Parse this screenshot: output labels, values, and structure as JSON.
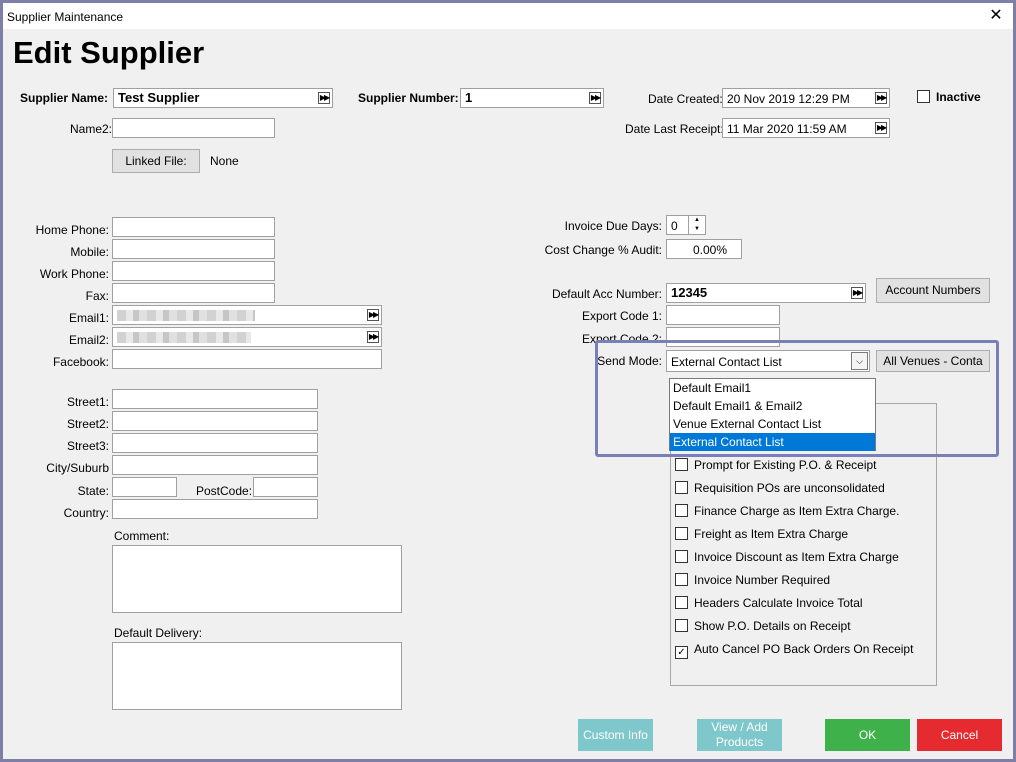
{
  "window": {
    "title": "Supplier Maintenance",
    "close_glyph": "✕"
  },
  "heading": "Edit Supplier",
  "supplier": {
    "name_label": "Supplier Name:",
    "name_value": "Test Supplier",
    "number_label": "Supplier Number:",
    "number_value": "1",
    "name2_label": "Name2:",
    "name2_value": "",
    "linked_file_button": "Linked File:",
    "linked_file_value": "None"
  },
  "dates": {
    "created_label": "Date Created:",
    "created_value": "20 Nov 2019 12:29 PM",
    "last_receipt_label": "Date Last Receipt:",
    "last_receipt_value": "11 Mar 2020 11:59 AM"
  },
  "inactive_label": "Inactive",
  "contact": {
    "home_phone_label": "Home Phone:",
    "mobile_label": "Mobile:",
    "work_phone_label": "Work Phone:",
    "fax_label": "Fax:",
    "email1_label": "Email1:",
    "email2_label": "Email2:",
    "facebook_label": "Facebook:"
  },
  "address": {
    "street1_label": "Street1:",
    "street2_label": "Street2:",
    "street3_label": "Street3:",
    "city_label": "City/Suburb",
    "state_label": "State:",
    "postcode_label": "PostCode:",
    "country_label": "Country:",
    "comment_label": "Comment:",
    "default_delivery_label": "Default Delivery:"
  },
  "billing": {
    "invoice_due_days_label": "Invoice Due Days:",
    "invoice_due_days_value": "0",
    "cost_change_label": "Cost Change % Audit:",
    "cost_change_value": "0.00%",
    "default_acc_label": "Default Acc Number:",
    "default_acc_value": "12345",
    "account_numbers_button": "Account Numbers",
    "export_code1_label": "Export Code 1:",
    "export_code2_label": "Export Code 2:",
    "send_mode_label": "Send Mode:",
    "send_mode_value": "External Contact List",
    "all_venues_button": "All Venues - Conta"
  },
  "send_mode_options": [
    "Default Email1",
    "Default Email1 & Email2",
    "Venue External Contact List",
    "External Contact List"
  ],
  "send_mode_selected_index": 3,
  "options": [
    {
      "label": "Prompt for Existing P.O. & Receipt",
      "checked": false
    },
    {
      "label": "Requisition POs are unconsolidated",
      "checked": false
    },
    {
      "label": "Finance Charge as Item Extra Charge.",
      "checked": false
    },
    {
      "label": "Freight as Item Extra Charge",
      "checked": false
    },
    {
      "label": "Invoice Discount as Item Extra Charge",
      "checked": false
    },
    {
      "label": "Invoice Number Required",
      "checked": false
    },
    {
      "label": "Headers Calculate Invoice Total",
      "checked": false
    },
    {
      "label": "Show P.O. Details on Receipt",
      "checked": false
    },
    {
      "label": "Auto Cancel PO Back Orders On Receipt",
      "checked": true
    }
  ],
  "footer": {
    "custom_info": "Custom Info",
    "view_add_products_line1": "View / Add",
    "view_add_products_line2": "Products",
    "ok": "OK",
    "cancel": "Cancel"
  },
  "colors": {
    "highlight_border": "#7b7fb8",
    "teal_button": "#7ec8cc",
    "ok_button": "#3fb14a",
    "cancel_button": "#e52b2f",
    "selected_item": "#0078d7"
  }
}
